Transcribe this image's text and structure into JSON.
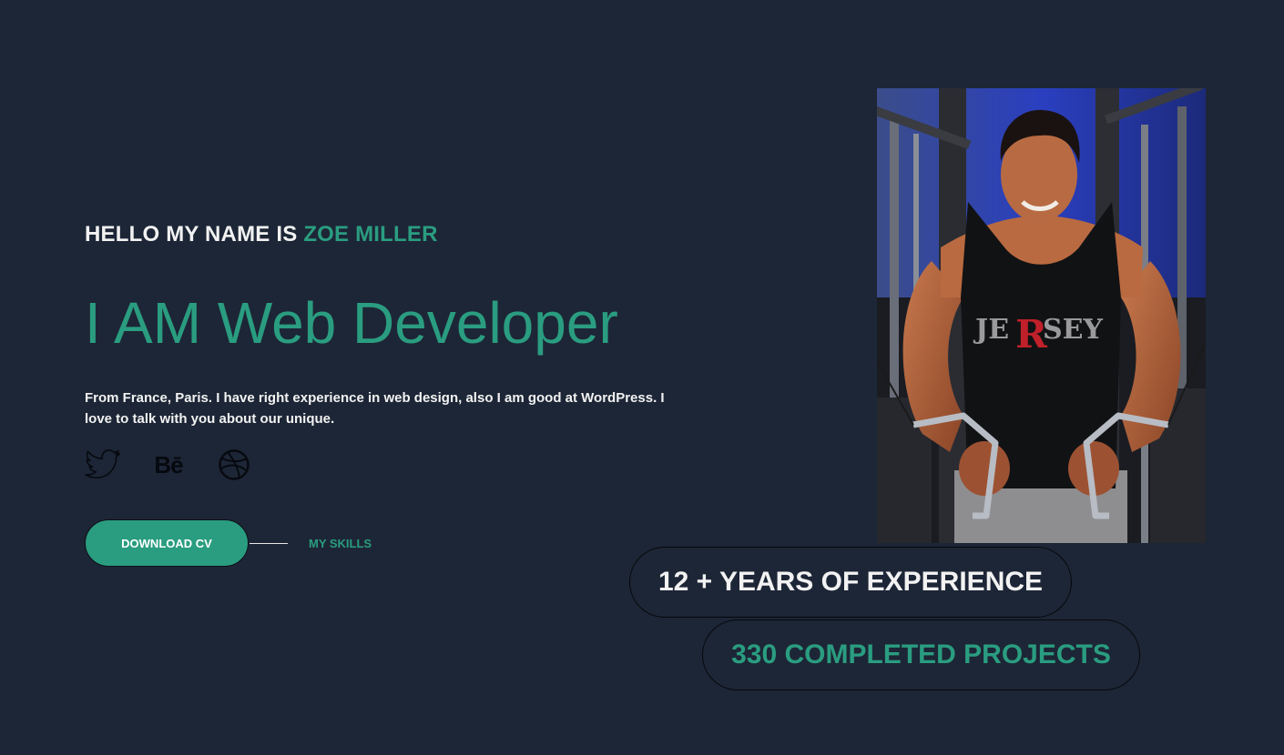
{
  "hero": {
    "greeting_prefix": "HELLO MY NAME IS ",
    "name": "ZOE MILLER",
    "headline": "I AM Web Developer",
    "bio": "From France, Paris. I have right experience in web design, also I am good at WordPress. I love to talk with you about our unique.",
    "behance_label": "Bē"
  },
  "socials": [
    {
      "icon": "twitter-icon"
    },
    {
      "icon": "behance-icon"
    },
    {
      "icon": "dribbble-icon"
    }
  ],
  "actions": {
    "download_label": "DOWNLOAD CV",
    "skills_label": "MY SKILLS"
  },
  "stats": {
    "experience": "12 + YEARS OF EXPERIENCE",
    "projects": "330 COMPLETED PROJECTS"
  },
  "colors": {
    "background": "#1d2636",
    "accent": "#2a9d80",
    "text": "#f2f2f2"
  }
}
